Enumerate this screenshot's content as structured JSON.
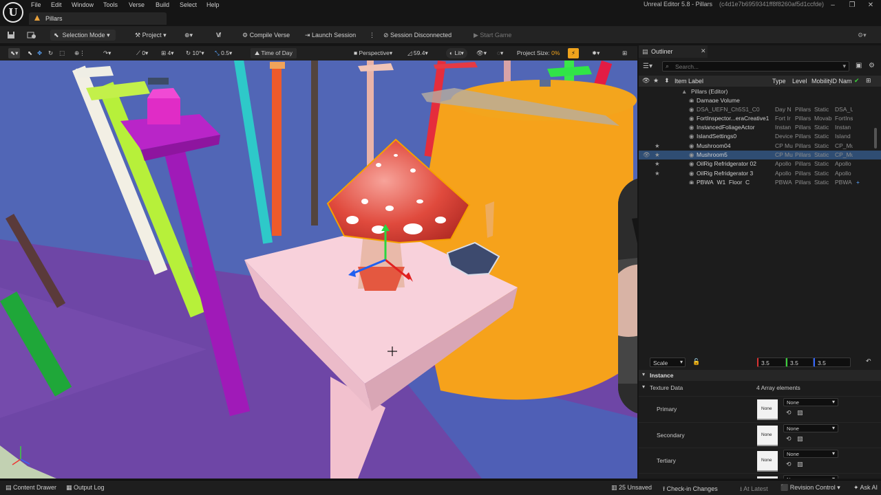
{
  "titlebar": {
    "menus": [
      "File",
      "Edit",
      "Window",
      "Tools",
      "Verse",
      "Build",
      "Select",
      "Help"
    ],
    "window_title": "Unreal Editor 5.8 - Pillars",
    "window_hash": "(c4d1e7b6959341ff8f8260af5d1ccfde)",
    "tab_label": "Pillars"
  },
  "toolbar": {
    "selection_mode": "Selection Mode",
    "project": "Project",
    "compile_verse": "Compile Verse",
    "launch_session": "Launch Session",
    "session_disconnected": "Session Disconnected",
    "start_game": "Start Game"
  },
  "viewport_toolbar": {
    "snap_angle_count": "0",
    "grid_value": "4",
    "rotation_snap": "10°",
    "scale_snap": "0.5",
    "time_of_day": "Time of Day",
    "perspective": "Perspective",
    "fov": "59.4",
    "lit": "Lit",
    "project_size_label": "Project Size:",
    "project_size_value": "0%"
  },
  "outliner": {
    "title": "Outliner",
    "search_placeholder": "Search...",
    "columns": [
      "Item Label",
      "Type",
      "Level",
      "Mobility",
      "ID Name"
    ],
    "root_label": "Pillars (Editor)",
    "rows": [
      {
        "label": "Damage Volume",
        "type": "",
        "level": "",
        "mobility": "",
        "id": ""
      },
      {
        "label": "DSA_UEFN_Ch5S1_C0",
        "type": "Day N",
        "level": "Pillars",
        "mobility": "Static",
        "id": "DSA_U"
      },
      {
        "label": "FortInspector...eraCreative1",
        "type": "Fort Ir",
        "level": "Pillars",
        "mobility": "Movab",
        "id": "FortIns"
      },
      {
        "label": "InstancedFoliageActor",
        "type": "Instan",
        "level": "Pillars",
        "mobility": "Static",
        "id": "Instan"
      },
      {
        "label": "IslandSettings0",
        "type": "Device",
        "level": "Pillars",
        "mobility": "Static",
        "id": "Island"
      },
      {
        "label": "Mushroom04",
        "type": "CP Mu",
        "level": "Pillars",
        "mobility": "Static",
        "id": "CP_Mu"
      },
      {
        "label": "Mushroom5",
        "type": "CP Mu",
        "level": "Pillars",
        "mobility": "Static",
        "id": "CP_Mu"
      },
      {
        "label": "OilRig Refridgerator 02",
        "type": "Apollo",
        "level": "Pillars",
        "mobility": "Static",
        "id": "Apollo"
      },
      {
        "label": "OilRig Refridgerator 3",
        "type": "Apollo",
        "level": "Pillars",
        "mobility": "Static",
        "id": "Apollo"
      },
      {
        "label": "PBWA_W1_Floor_C",
        "type": "PBWA",
        "level": "Pillars",
        "mobility": "Static",
        "id": "PBWA"
      }
    ]
  },
  "details": {
    "scale_label": "Scale",
    "scale_x": "3.5",
    "scale_y": "3.5",
    "scale_z": "3.5",
    "instance_section": "Instance",
    "texture_data_label": "Texture Data",
    "array_elements": "4 Array elements",
    "slots": [
      {
        "label": "Primary",
        "thumb": "None",
        "value": "None"
      },
      {
        "label": "Secondary",
        "thumb": "None",
        "value": "None"
      },
      {
        "label": "Tertiary",
        "thumb": "None",
        "value": "None"
      },
      {
        "label": "",
        "thumb": "",
        "value": "None"
      }
    ]
  },
  "statusbar": {
    "content_drawer": "Content Drawer",
    "output_log": "Output Log",
    "unsaved": "25 Unsaved",
    "check_in": "Check-in Changes",
    "at_latest": "At Latest",
    "revision_control": "Revision Control",
    "ask_ai": "Ask AI"
  },
  "colors": {
    "viewport_bg": "#4f64b6",
    "accent_orange": "#f0a31c",
    "selection_blue": "#2f4d73"
  }
}
